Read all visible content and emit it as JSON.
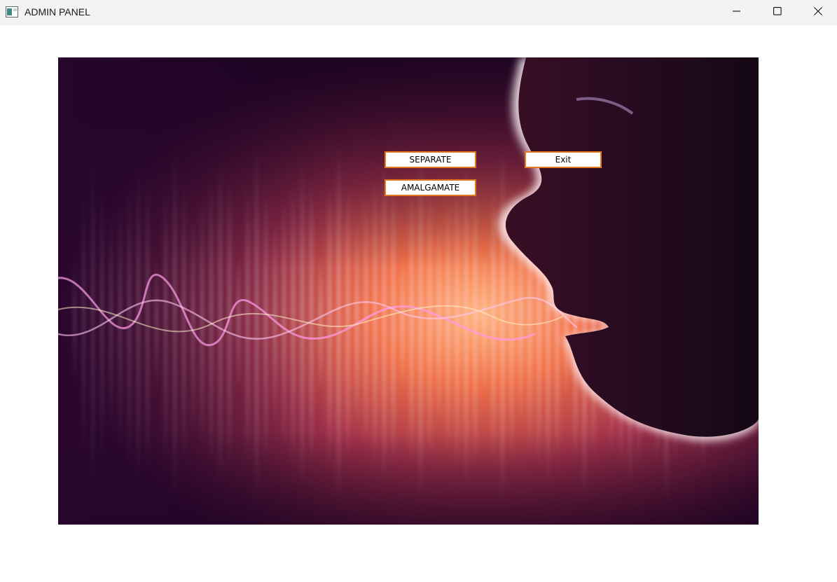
{
  "window": {
    "title": "ADMIN PANEL",
    "icon": "app-window-icon",
    "controls": [
      "minimize-icon",
      "maximize-icon",
      "close-icon"
    ]
  },
  "main": {
    "background_image": "voice-soundwave-woman-profile",
    "buttons": {
      "separate_label": "SEPARATE",
      "amalgamate_label": "AMALGAMATE",
      "exit_label": "Exit"
    }
  },
  "colors": {
    "button_border": "#e07a1c",
    "titlebar_bg": "#f3f3f3"
  }
}
